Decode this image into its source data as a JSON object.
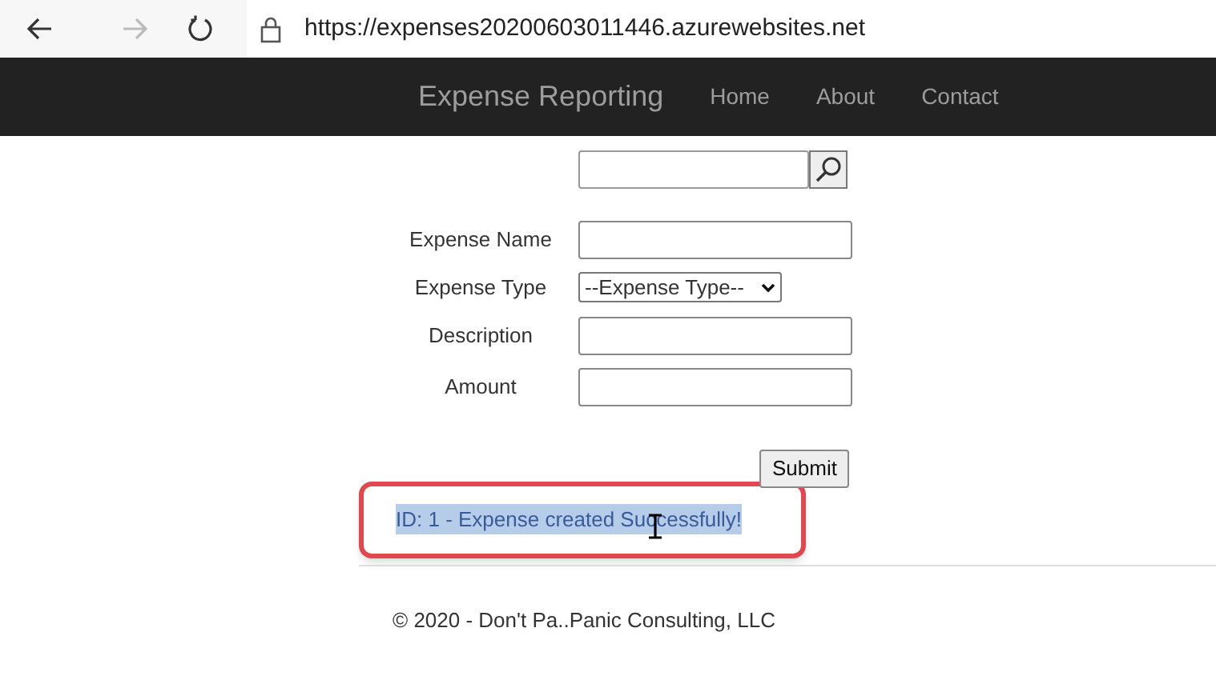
{
  "browser": {
    "url": "https://expenses20200603011446.azurewebsites.net"
  },
  "navbar": {
    "brand": "Expense Reporting",
    "links": [
      "Home",
      "About",
      "Contact"
    ]
  },
  "form": {
    "fields": [
      {
        "kind": "text",
        "label": "Expense Name"
      },
      {
        "kind": "select",
        "label": "Expense Type",
        "value": "--Expense Type--"
      },
      {
        "kind": "text",
        "label": "Description"
      },
      {
        "kind": "text",
        "label": "Amount"
      }
    ],
    "submit": "Submit"
  },
  "message": {
    "text": "ID: 1 - Expense created Successfully!",
    "highlighted": true
  },
  "footer": "© 2020 - Don't Pa..Panic Consulting, LLC"
}
